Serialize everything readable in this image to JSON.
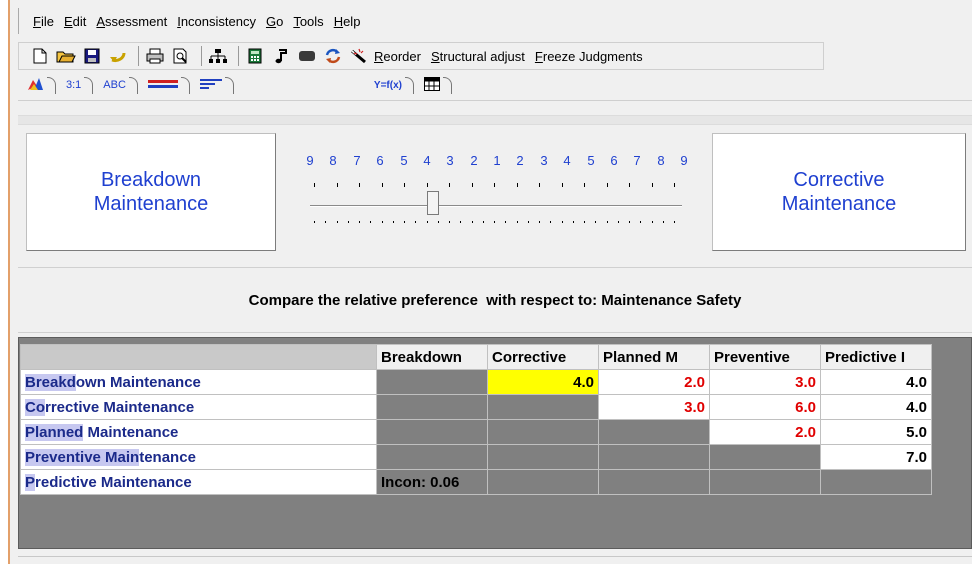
{
  "menu": {
    "items": [
      {
        "underline": "F",
        "rest": "ile"
      },
      {
        "underline": "E",
        "rest": "dit"
      },
      {
        "underline": "A",
        "rest": "ssessment"
      },
      {
        "underline": "I",
        "rest": "nconsistency"
      },
      {
        "underline": "G",
        "rest": "o"
      },
      {
        "underline": "T",
        "rest": "ools"
      },
      {
        "underline": "H",
        "rest": "elp"
      }
    ]
  },
  "toolbar": {
    "reorder": {
      "underline": "R",
      "rest": "eorder"
    },
    "structural_adjust": {
      "underline": "S",
      "rest": "tructural adjust"
    },
    "freeze_judgments": {
      "underline": "F",
      "rest": "reeze Judgments"
    }
  },
  "tabs": {
    "ratio": "3:1",
    "verbal": "ABC",
    "formula": "Y=f(x)"
  },
  "comparison": {
    "left": "Breakdown Maintenance",
    "right": "Corrective Maintenance",
    "scale_labels": [
      "9",
      "8",
      "7",
      "6",
      "5",
      "4",
      "3",
      "2",
      "1",
      "2",
      "3",
      "4",
      "5",
      "6",
      "7",
      "8",
      "9"
    ],
    "slider_position_fraction": 0.33,
    "prompt": "Compare the relative preference  with respect to: Maintenance Safety"
  },
  "matrix": {
    "columns": [
      "Breakdown",
      "Corrective",
      "Planned M",
      "Preventive",
      "Predictive I"
    ],
    "rows": [
      {
        "highlight": "Breakd",
        "rest": "own Maintenance",
        "cells": [
          "",
          "4.0",
          "2.0",
          "3.0",
          "4.0"
        ]
      },
      {
        "highlight": "Co",
        "rest": "rrective Maintenance",
        "cells": [
          "",
          "",
          "3.0",
          "6.0",
          "4.0"
        ]
      },
      {
        "highlight": "Planned",
        "rest": " Maintenance",
        "cells": [
          "",
          "",
          "",
          "2.0",
          "5.0"
        ]
      },
      {
        "highlight": "Preventive Main",
        "rest": "tenance",
        "cells": [
          "",
          "",
          "",
          "",
          "7.0"
        ]
      },
      {
        "highlight": "P",
        "rest": "redictive Maintenance",
        "cells": [
          "Incon: 0.06",
          "",
          "",
          "",
          ""
        ]
      }
    ]
  },
  "colors": {
    "blue_text": "#1f40d0",
    "red_value": "#e00000",
    "selected_cell": "#ffff00",
    "gray_cell": "#808080"
  }
}
